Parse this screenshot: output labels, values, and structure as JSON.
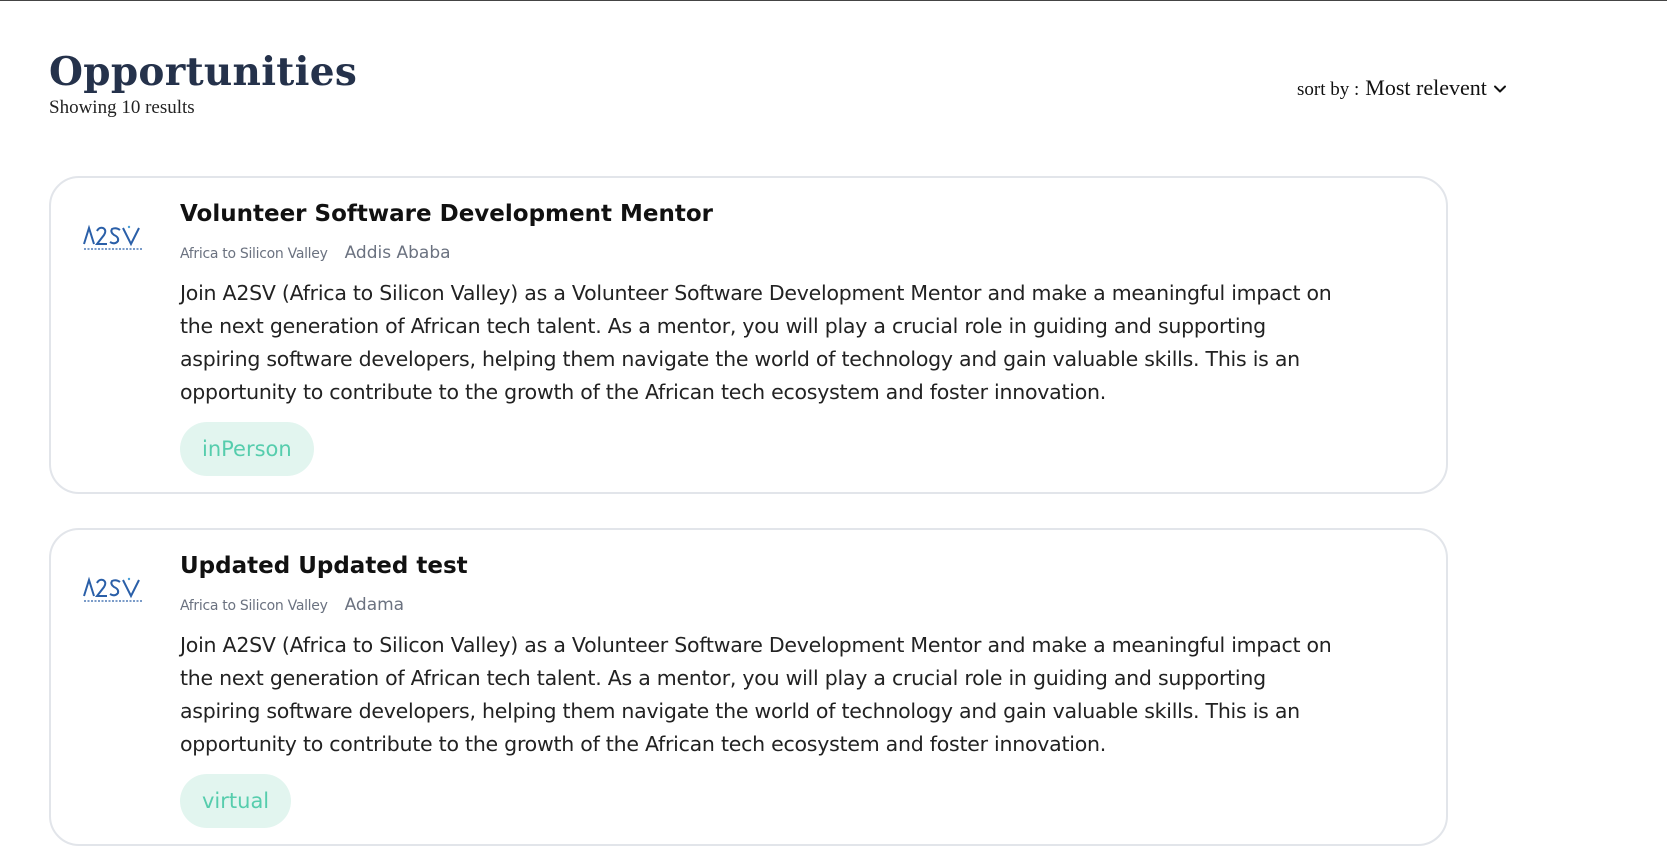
{
  "header": {
    "title": "Opportunities",
    "result_count": "Showing 10 results"
  },
  "sort": {
    "label": "sort by :",
    "value": "Most relevent"
  },
  "icons": {
    "sort_dropdown": "chevron-down-icon",
    "company_logo": "a2sv-logo"
  },
  "colors": {
    "title": "#25324b",
    "tag_background": "#e2f5ef",
    "tag_text": "#56cdad",
    "logo_blue": "#2a5fa8"
  },
  "opportunities": [
    {
      "title": "Volunteer Software Development Mentor",
      "company": "Africa to Silicon Valley",
      "location": "Addis Ababa",
      "description": "Join A2SV (Africa to Silicon Valley) as a Volunteer Software Development Mentor and make a meaningful impact on the next generation of African tech talent. As a mentor, you will play a crucial role in guiding and supporting aspiring software developers, helping them navigate the world of technology and gain valuable skills. This is an opportunity to contribute to the growth of the African tech ecosystem and foster innovation.",
      "tag": "inPerson"
    },
    {
      "title": "Updated Updated test",
      "company": "Africa to Silicon Valley",
      "location": "Adama",
      "description": "Join A2SV (Africa to Silicon Valley) as a Volunteer Software Development Mentor and make a meaningful impact on the next generation of African tech talent. As a mentor, you will play a crucial role in guiding and supporting aspiring software developers, helping them navigate the world of technology and gain valuable skills. This is an opportunity to contribute to the growth of the African tech ecosystem and foster innovation.",
      "tag": "virtual"
    }
  ]
}
